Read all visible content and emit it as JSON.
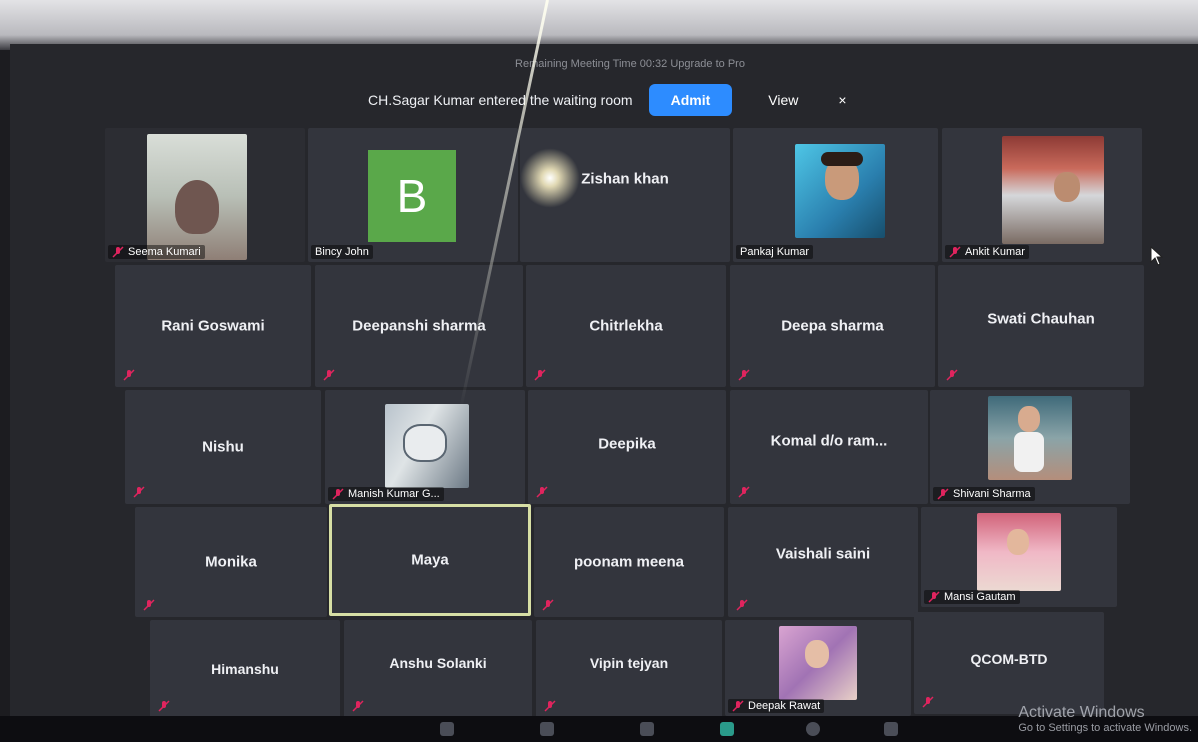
{
  "meeting": {
    "timer_text": "Remaining Meeting Time 00:32 Upgrade to Pro",
    "notification": {
      "message": "CH.Sagar Kumar entered the waiting room",
      "admit_label": "Admit",
      "view_label": "View",
      "close_glyph": "×"
    }
  },
  "participants": [
    {
      "name": "Seema Kumari",
      "video": true,
      "muted": true
    },
    {
      "name": "Bincy John",
      "avatar_letter": "B",
      "muted": false
    },
    {
      "name": "Zishan khan",
      "muted": false
    },
    {
      "name": "Pankaj Kumar",
      "video": true,
      "muted": false
    },
    {
      "name": "Ankit Kumar",
      "video": true,
      "muted": true
    },
    {
      "name": "Rani Goswami",
      "muted": true
    },
    {
      "name": "Deepanshi sharma",
      "muted": true
    },
    {
      "name": "Chitrlekha",
      "muted": true
    },
    {
      "name": "Deepa sharma",
      "muted": true
    },
    {
      "name": "Swati Chauhan",
      "muted": true
    },
    {
      "name": "Nishu",
      "muted": true
    },
    {
      "name": "Manish Kumar G...",
      "video": true,
      "muted": true
    },
    {
      "name": "Deepika",
      "muted": true
    },
    {
      "name": "Komal  d/o ram...",
      "muted": true
    },
    {
      "name": "Shivani Sharma",
      "video": true,
      "muted": true
    },
    {
      "name": "Monika",
      "muted": true
    },
    {
      "name": "Maya",
      "muted": false,
      "active_speaker": true
    },
    {
      "name": "poonam meena",
      "muted": true
    },
    {
      "name": "Vaishali saini",
      "muted": true
    },
    {
      "name": "Mansi Gautam",
      "video": true,
      "muted": true
    },
    {
      "name": "Himanshu",
      "muted": true
    },
    {
      "name": "Anshu Solanki",
      "muted": true
    },
    {
      "name": "Vipin tejyan",
      "muted": true
    },
    {
      "name": "Deepak Rawat",
      "video": true,
      "muted": true
    },
    {
      "name": "QCOM-BTD",
      "muted": true
    }
  ],
  "windows_watermark": {
    "title": "Activate Windows",
    "subtitle": "Go to Settings to activate Windows."
  },
  "colors": {
    "admit_button": "#2d8cff",
    "tile_background": "#33353d",
    "avatar_green": "#5aa84a",
    "mute_icon": "#e0245e",
    "active_speaker_border": "#d7dfa5"
  },
  "icons": {
    "mute": "microphone-muted-icon",
    "cursor": "mouse-pointer-icon"
  }
}
